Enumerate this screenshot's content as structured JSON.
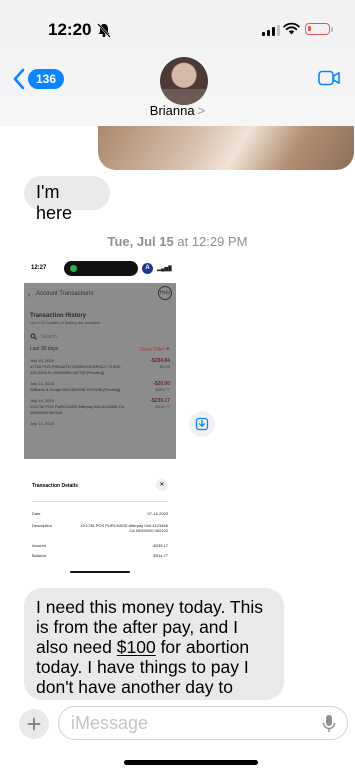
{
  "status": {
    "time": "12:20"
  },
  "header": {
    "back_count": "136",
    "contact_name": "Brianna",
    "contact_chevron": ">"
  },
  "messages": {
    "first": "I'm here",
    "date_day": "Tue, Jul 15",
    "date_time": " at 12:29 PM",
    "last_before": "I need this money today. This is from the after pay, and I also need ",
    "last_money": "$100",
    "last_after": " for abortion today. I have things to pay I don't have another day to wait."
  },
  "screenshot": {
    "time": "12:27",
    "badge_letter": "A",
    "nav_title": "Account Transactions",
    "help": "Help",
    "history_title": "Transaction History",
    "history_sub": "Up to 24 months of history are available",
    "search": "Search",
    "last_days": "Last 30 days",
    "show_filter": "Show Filter",
    "transactions": [
      {
        "date": "July 15, 2025",
        "desc": "47760 POS PREAUTH VZWRLSS*APOCC VI 800-922-0204 FL 99999999 047760 [Pending]",
        "amount": "-$284.84",
        "balance": "$9.93"
      },
      {
        "date": "July 14, 2025",
        "desc": "Williams & Fudge D00182903B 9743336 [Pending]",
        "amount": "-$20.00",
        "balance": "$294.77"
      },
      {
        "date": "July 14, 2025",
        "desc": "XX1736 POS PURCHASE Afterpay 044-4123456 CA 00000000 082102",
        "amount": "-$239.17",
        "balance": "$314.77"
      },
      {
        "date": "July 14, 2025"
      }
    ],
    "sheet_title": "Transaction Details",
    "details": [
      {
        "label": "Date",
        "value": "07-14-2025"
      },
      {
        "label": "Description",
        "value": "XX1736 POS PURCHASE Afterpay 044-4123456 CA 00000000 082102"
      },
      {
        "label": "Amount",
        "value": "-$239.17"
      },
      {
        "label": "Balance",
        "value": "$314.77"
      }
    ]
  },
  "input": {
    "placeholder": "iMessage"
  },
  "colors": {
    "accent": "#0a84ff",
    "bubble_gray": "#e9e9eb",
    "battery_low": "#e25858"
  }
}
